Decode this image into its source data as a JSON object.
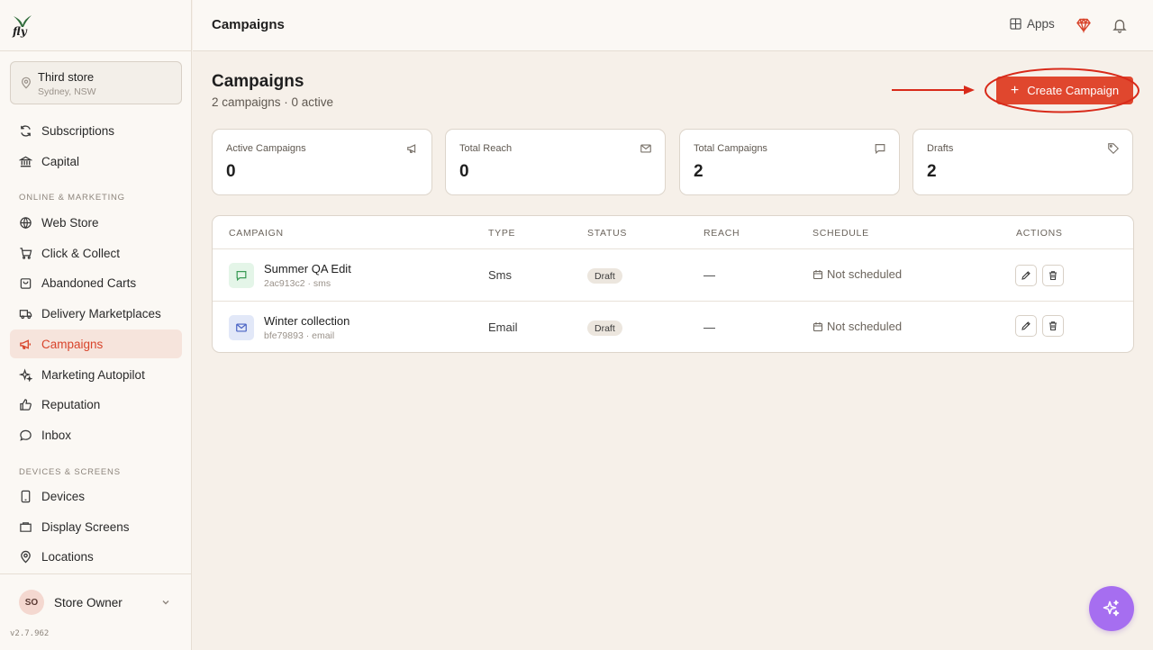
{
  "app": {
    "logo_text": "fly",
    "version": "v2.7.962"
  },
  "store": {
    "name": "Third store",
    "location": "Sydney, NSW"
  },
  "sidebar": {
    "top_items": [
      {
        "label": "Subscriptions",
        "icon": "refresh-icon"
      },
      {
        "label": "Capital",
        "icon": "bank-icon"
      }
    ],
    "sections": [
      {
        "title": "ONLINE & MARKETING",
        "items": [
          {
            "label": "Web Store",
            "icon": "globe-icon"
          },
          {
            "label": "Click & Collect",
            "icon": "cart-icon"
          },
          {
            "label": "Abandoned Carts",
            "icon": "basket-icon"
          },
          {
            "label": "Delivery Marketplaces",
            "icon": "truck-icon"
          },
          {
            "label": "Campaigns",
            "icon": "megaphone-icon",
            "active": true
          },
          {
            "label": "Marketing Autopilot",
            "icon": "sparkles-icon"
          },
          {
            "label": "Reputation",
            "icon": "thumbs-up-icon"
          },
          {
            "label": "Inbox",
            "icon": "chat-icon"
          }
        ]
      },
      {
        "title": "DEVICES & SCREENS",
        "items": [
          {
            "label": "Devices",
            "icon": "tablet-icon"
          },
          {
            "label": "Display Screens",
            "icon": "screen-icon"
          },
          {
            "label": "Locations",
            "icon": "pin-icon"
          }
        ]
      }
    ]
  },
  "user": {
    "initials": "SO",
    "name": "Store Owner"
  },
  "header": {
    "title": "Campaigns",
    "apps_label": "Apps"
  },
  "page": {
    "title": "Campaigns",
    "subtitle": "2 campaigns · 0 active",
    "create_label": "Create Campaign"
  },
  "stats": [
    {
      "label": "Active Campaigns",
      "value": "0",
      "icon": "megaphone-icon"
    },
    {
      "label": "Total Reach",
      "value": "0",
      "icon": "mail-icon"
    },
    {
      "label": "Total Campaigns",
      "value": "2",
      "icon": "message-icon"
    },
    {
      "label": "Drafts",
      "value": "2",
      "icon": "tag-icon"
    }
  ],
  "table": {
    "headers": [
      "CAMPAIGN",
      "TYPE",
      "STATUS",
      "REACH",
      "SCHEDULE",
      "ACTIONS"
    ],
    "rows": [
      {
        "name": "Summer QA Edit",
        "meta": "2ac913c2 · sms",
        "type": "Sms",
        "status": "Draft",
        "reach": "—",
        "schedule": "Not scheduled",
        "channel_icon": "sms-icon"
      },
      {
        "name": "Winter collection",
        "meta": "bfe79893 · email",
        "type": "Email",
        "status": "Draft",
        "reach": "—",
        "schedule": "Not scheduled",
        "channel_icon": "mail-icon"
      }
    ]
  },
  "colors": {
    "accent": "#e0472e",
    "sidebar_active_bg": "#f6e4dc",
    "fab": "#a66ef0",
    "annotation": "#d82a1a"
  }
}
